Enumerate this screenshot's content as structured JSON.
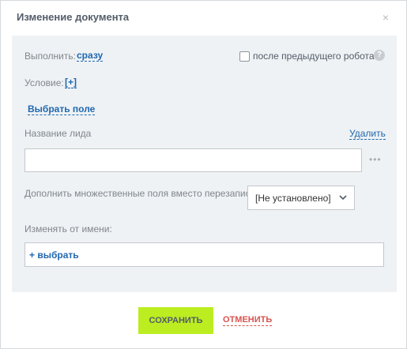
{
  "dialog": {
    "title": "Изменение документа",
    "close_glyph": "×"
  },
  "form": {
    "execute_label": "Выполнить:",
    "execute_value": "сразу",
    "after_robot_label": "после предыдущего робота",
    "help_glyph": "?",
    "condition_label": "Условие:",
    "condition_value": "[+]",
    "choose_field": "Выбрать поле",
    "field_name_label": "Название лида",
    "delete_label": "Удалить",
    "field_value": "",
    "dots_glyph": "•••",
    "multiple_label": "Дополнить множественные поля вместо перезаписи:",
    "multiple_selected": "[Не установлено]",
    "change_as_label": "Изменять от имени:",
    "pick_user": "+ выбрать"
  },
  "footer": {
    "save_label": "СОХРАНИТЬ",
    "cancel_label": "ОТМЕНИТЬ"
  },
  "colors": {
    "link": "#2067b0",
    "save_button": "#bbed21",
    "cancel": "#d9534f",
    "panel": "#eef2f4"
  },
  "icons": {
    "close": "close-icon",
    "help": "help-icon",
    "dots": "dots-icon",
    "dropdown": "chevron-down-icon"
  }
}
